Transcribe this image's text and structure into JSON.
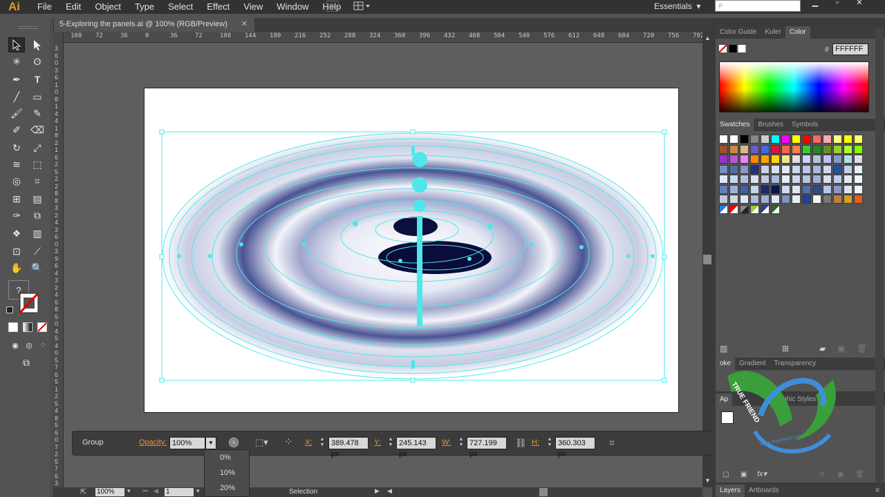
{
  "app": {
    "logo": "Ai",
    "workspace": "Essentials",
    "bridge_label": "Br"
  },
  "menu": [
    "File",
    "Edit",
    "Object",
    "Type",
    "Select",
    "Effect",
    "View",
    "Window",
    "Help"
  ],
  "document": {
    "tab_title": "5-Exploring the panels.ai @ 100% (RGB/Preview)"
  },
  "rulers": {
    "horizontal": [
      "108",
      "72",
      "36",
      "0",
      "36",
      "72",
      "108",
      "144",
      "180",
      "216",
      "252",
      "288",
      "324",
      "360",
      "396",
      "432",
      "468",
      "504",
      "540",
      "576",
      "612",
      "648",
      "684",
      "720",
      "756",
      "792"
    ],
    "vertical": [
      "3",
      "6",
      "0",
      "3",
      "6",
      "1",
      "0",
      "8",
      "1",
      "4",
      "4",
      "1",
      "8",
      "2",
      "1",
      "6",
      "2",
      "5",
      "2",
      "2",
      "8",
      "8",
      "3",
      "2",
      "4",
      "3",
      "6",
      "0",
      "3",
      "9",
      "6",
      "4",
      "3",
      "2",
      "4",
      "6",
      "8",
      "5",
      "0",
      "4",
      "5",
      "4",
      "0",
      "5",
      "7",
      "6",
      "5",
      "1",
      "2",
      "5",
      "4",
      "8",
      "5",
      "6",
      "0",
      "7",
      "2",
      "5",
      "7",
      "6",
      "3",
      "0"
    ]
  },
  "control_bar": {
    "selection_label": "Group",
    "opacity_label": "Opacity:",
    "opacity_value": "100%",
    "x_label": "X:",
    "x_value": "389.478 px",
    "y_label": "Y:",
    "y_value": "245.143 px",
    "w_label": "W:",
    "w_value": "727.199 px",
    "h_label": "H:",
    "h_value": "360.303 px"
  },
  "opacity_dropdown": [
    "0%",
    "10%",
    "20%"
  ],
  "status_bar": {
    "zoom": "100%",
    "artboard": "1",
    "tool": "Selection"
  },
  "color_panel": {
    "tabs": [
      "Color Guide",
      "Kuler",
      "Color"
    ],
    "active": "Color",
    "hex_label": "#",
    "hex_value": "FFFFFF"
  },
  "swatches_panel": {
    "tabs": [
      "Swatches",
      "Brushes",
      "Symbols"
    ],
    "active": "Swatches"
  },
  "stroke_panel": {
    "tabs": [
      "Stroke",
      "Gradient",
      "Transparency"
    ],
    "stroke_partial": "oke"
  },
  "appearance_panel": {
    "tab_partial": "Ap",
    "graphic_styles": "Graphic Styles"
  },
  "layers_panel": {
    "tabs": [
      "Layers",
      "Artboards"
    ]
  },
  "watermark": {
    "text": "TRUE FRIEND",
    "url": "www.truefriend.com"
  },
  "colors": {
    "selection": "#4fe7ea",
    "accent_orange": "#e8962e",
    "ui_dark": "#3c3c3c",
    "ui_mid": "#535353"
  }
}
